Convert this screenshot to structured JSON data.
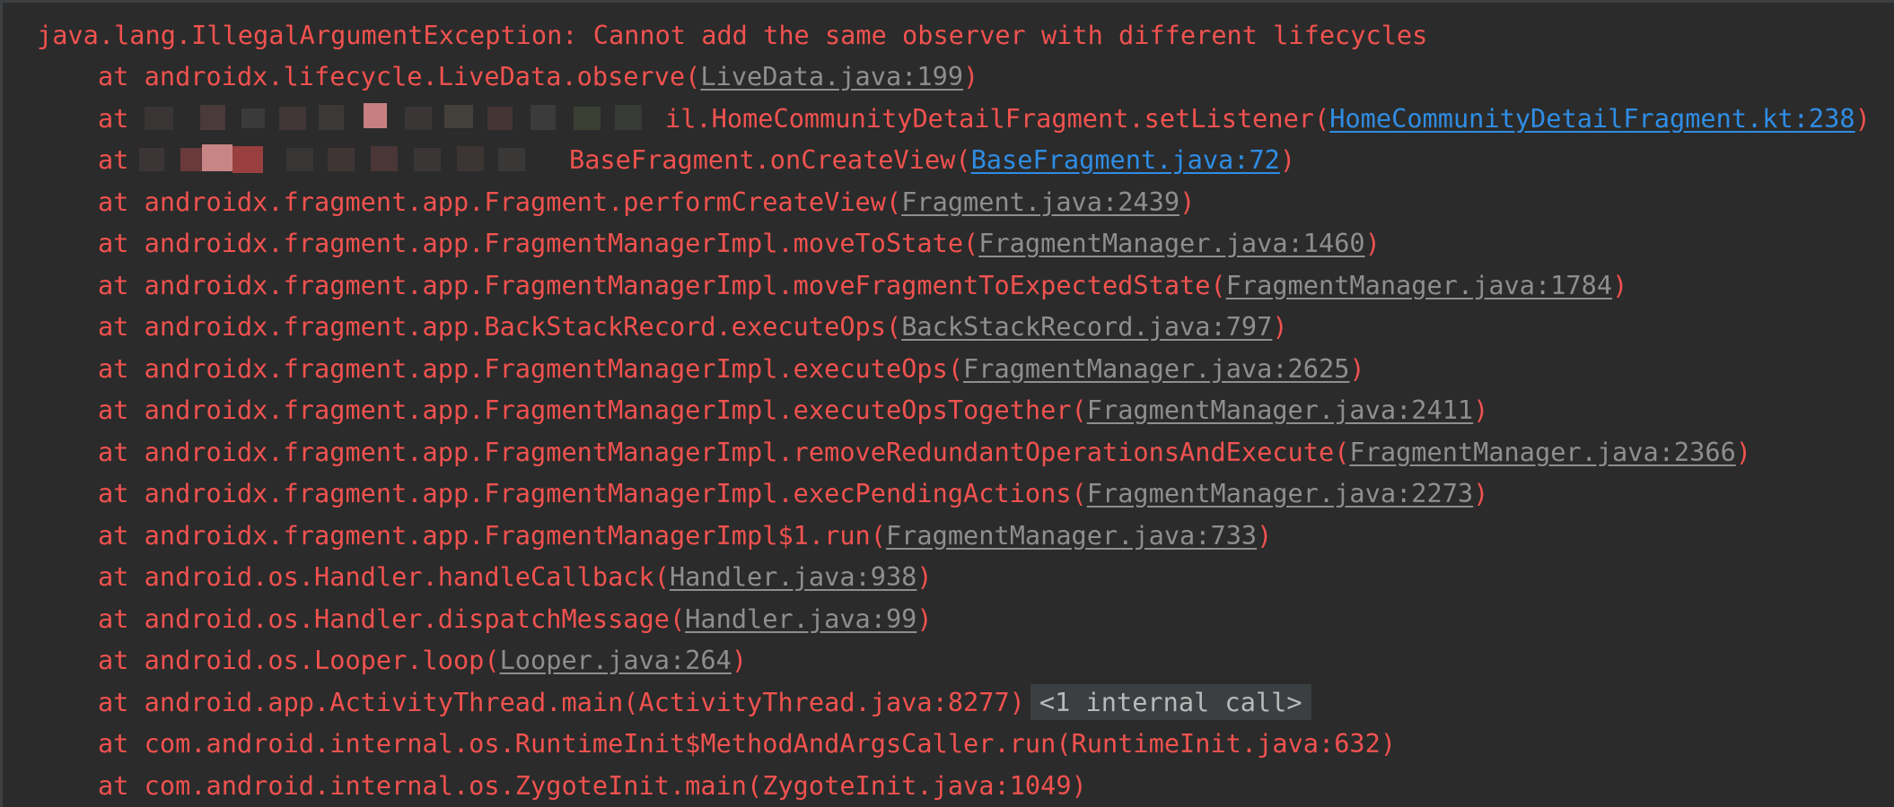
{
  "colors": {
    "background": "#2b2b2b",
    "error_text": "#f0524f",
    "library_link": "#8e8e8e",
    "user_link": "#2f8de4",
    "folded_bg": "#3c3f41"
  },
  "exception": {
    "message": "java.lang.IllegalArgumentException: Cannot add the same observer with different lifecycles"
  },
  "frames": [
    {
      "method": "at androidx.lifecycle.LiveData.observe(",
      "source": "LiveData.java:199",
      "close": ")",
      "link_type": "library"
    },
    {
      "prefix": "at",
      "method": "il.HomeCommunityDetailFragment.setListener(",
      "source": "HomeCommunityDetailFragment.kt:238",
      "close": ")",
      "link_type": "user",
      "redacted": true
    },
    {
      "prefix": "at",
      "method": "BaseFragment.onCreateView(",
      "source": "BaseFragment.java:72",
      "close": ")",
      "link_type": "user",
      "redacted": true
    },
    {
      "method": "at androidx.fragment.app.Fragment.performCreateView(",
      "source": "Fragment.java:2439",
      "close": ")",
      "link_type": "library"
    },
    {
      "method": "at androidx.fragment.app.FragmentManagerImpl.moveToState(",
      "source": "FragmentManager.java:1460",
      "close": ")",
      "link_type": "library"
    },
    {
      "method": "at androidx.fragment.app.FragmentManagerImpl.moveFragmentToExpectedState(",
      "source": "FragmentManager.java:1784",
      "close": ")",
      "link_type": "library"
    },
    {
      "method": "at androidx.fragment.app.BackStackRecord.executeOps(",
      "source": "BackStackRecord.java:797",
      "close": ")",
      "link_type": "library"
    },
    {
      "method": "at androidx.fragment.app.FragmentManagerImpl.executeOps(",
      "source": "FragmentManager.java:2625",
      "close": ")",
      "link_type": "library"
    },
    {
      "method": "at androidx.fragment.app.FragmentManagerImpl.executeOpsTogether(",
      "source": "FragmentManager.java:2411",
      "close": ")",
      "link_type": "library"
    },
    {
      "method": "at androidx.fragment.app.FragmentManagerImpl.removeRedundantOperationsAndExecute(",
      "source": "FragmentManager.java:2366",
      "close": ")",
      "link_type": "library"
    },
    {
      "method": "at androidx.fragment.app.FragmentManagerImpl.execPendingActions(",
      "source": "FragmentManager.java:2273",
      "close": ")",
      "link_type": "library"
    },
    {
      "method": "at androidx.fragment.app.FragmentManagerImpl$1.run(",
      "source": "FragmentManager.java:733",
      "close": ")",
      "link_type": "library"
    },
    {
      "method": "at android.os.Handler.handleCallback(",
      "source": "Handler.java:938",
      "close": ")",
      "link_type": "library"
    },
    {
      "method": "at android.os.Handler.dispatchMessage(",
      "source": "Handler.java:99",
      "close": ")",
      "link_type": "library"
    },
    {
      "method": "at android.os.Looper.loop(",
      "source": "Looper.java:264",
      "close": ")",
      "link_type": "library"
    },
    {
      "method": "at android.app.ActivityThread.main(ActivityThread.java:8277)",
      "folded": "<1 internal call>"
    },
    {
      "method": "at com.android.internal.os.RuntimeInit$MethodAndArgsCaller.run(RuntimeInit.java:632)"
    },
    {
      "method": "at com.android.internal.os.ZygoteInit.main(ZygoteInit.java:1049)"
    }
  ]
}
